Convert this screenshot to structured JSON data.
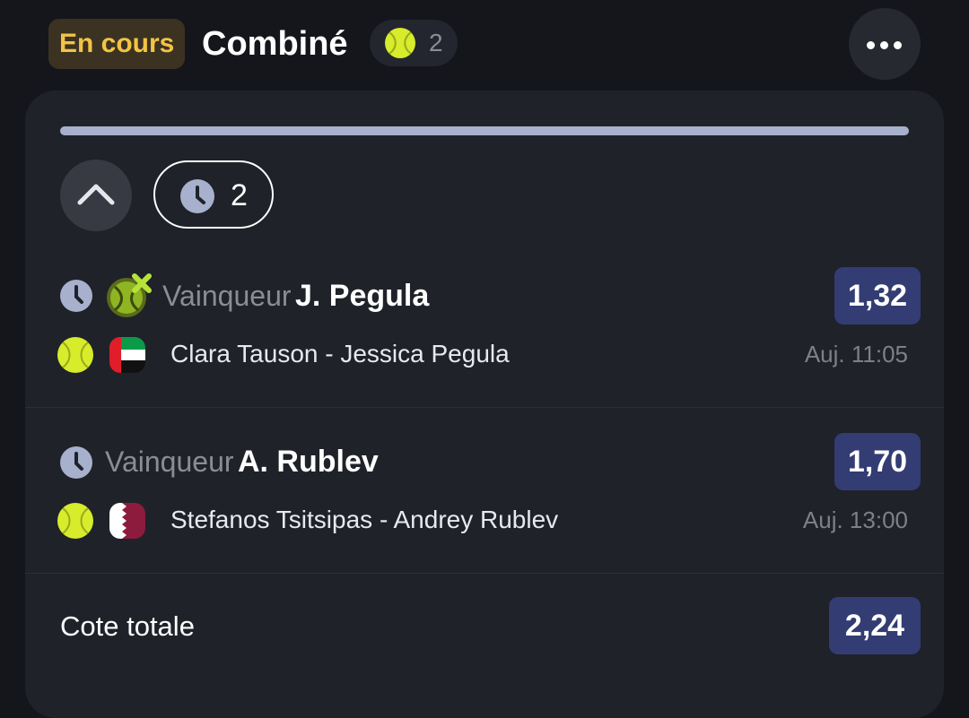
{
  "header": {
    "status": "En cours",
    "title": "Combiné",
    "sport_icon": "tennis-ball-icon",
    "sport_count": "2",
    "more_icon": "more-dots-icon"
  },
  "colors": {
    "background": "#14161c",
    "card": "#1f2229",
    "status_bg": "#3b3222",
    "status_text": "#f2c443",
    "odds_bg": "#333c73",
    "progress_fill": "#a7b0cc",
    "ball": "#d7ec2b"
  },
  "card": {
    "progress": 1.0,
    "pending_count": "2",
    "collapse_icon": "chevron-up-icon",
    "selections": [
      {
        "market": "Vainqueur",
        "pick": "J. Pegula",
        "odds": "1,32",
        "match": "Clara Tauson - Jessica Pegula",
        "time": "Auj. 11:05",
        "flag": "uae-flag-icon",
        "badge": "tennis-cross-icon"
      },
      {
        "market": "Vainqueur",
        "pick": "A. Rublev",
        "odds": "1,70",
        "match": "Stefanos Tsitsipas - Andrey Rublev",
        "time": "Auj. 13:00",
        "flag": "qatar-flag-icon"
      }
    ],
    "total_label": "Cote totale",
    "total_odds": "2,24"
  }
}
